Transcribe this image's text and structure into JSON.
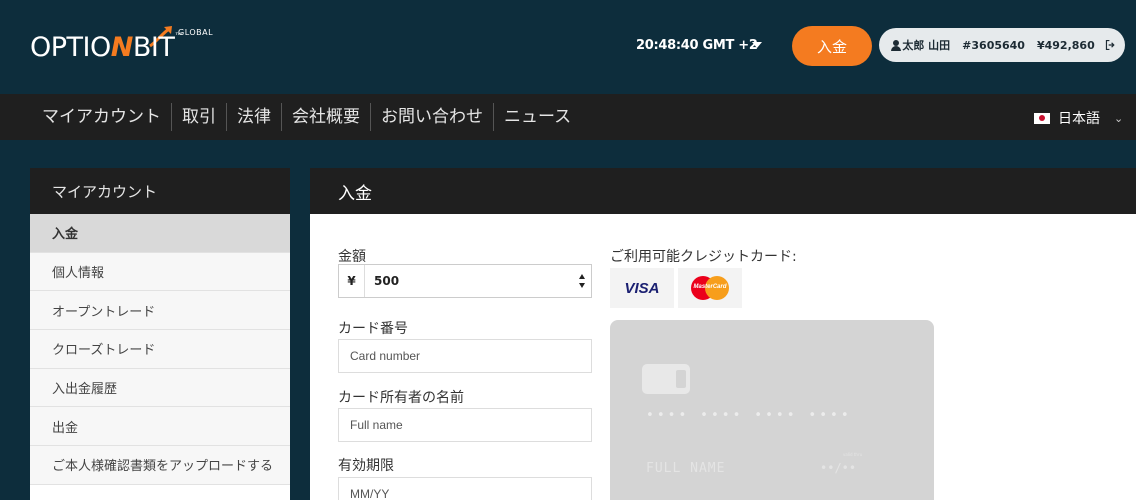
{
  "header": {
    "logo": {
      "part1": "OPTIO",
      "part2": "N",
      "part3": "BIT",
      "tm": "™",
      "global": "GLOBAL"
    },
    "clock": "20:48:40 GMT +2",
    "deposit_label": "入金",
    "account": {
      "name": "太郎 山田",
      "id": "#3605640",
      "balance": "¥492,860"
    },
    "colors": {
      "accent": "#f47b20",
      "header_bg": "#0d2d3c",
      "nav_bg": "#1f1f1f"
    }
  },
  "nav": {
    "items": [
      {
        "label": "マイアカウント"
      },
      {
        "label": "取引"
      },
      {
        "label": "法律"
      },
      {
        "label": "会社概要"
      },
      {
        "label": "お問い合わせ"
      },
      {
        "label": "ニュース"
      }
    ],
    "language": "日本語",
    "language_icon": "japan-flag-icon"
  },
  "sidebar": {
    "title": "マイアカウント",
    "items": [
      {
        "label": "入金",
        "active": true
      },
      {
        "label": "個人情報"
      },
      {
        "label": "オープントレード"
      },
      {
        "label": "クローズトレード"
      },
      {
        "label": "入出金履歴"
      },
      {
        "label": "出金"
      },
      {
        "label": "ご本人様確認書類をアップロードする"
      }
    ]
  },
  "main": {
    "title": "入金",
    "amount": {
      "label": "金額",
      "currency": "¥",
      "value": "500"
    },
    "card_number": {
      "label": "カード番号",
      "placeholder": "Card number"
    },
    "card_holder": {
      "label": "カード所有者の名前",
      "placeholder": "Full name"
    },
    "expiry": {
      "label": "有効期限",
      "placeholder": "MM/YY"
    },
    "cards": {
      "label": "ご利用可能クレジットカード:",
      "visa": "VISA",
      "mastercard": "MasterCard"
    },
    "preview": {
      "number": "•••• •••• •••• ••••",
      "name": "FULL NAME",
      "valid_thru": "valid thru",
      "expiry": "••/••"
    }
  }
}
